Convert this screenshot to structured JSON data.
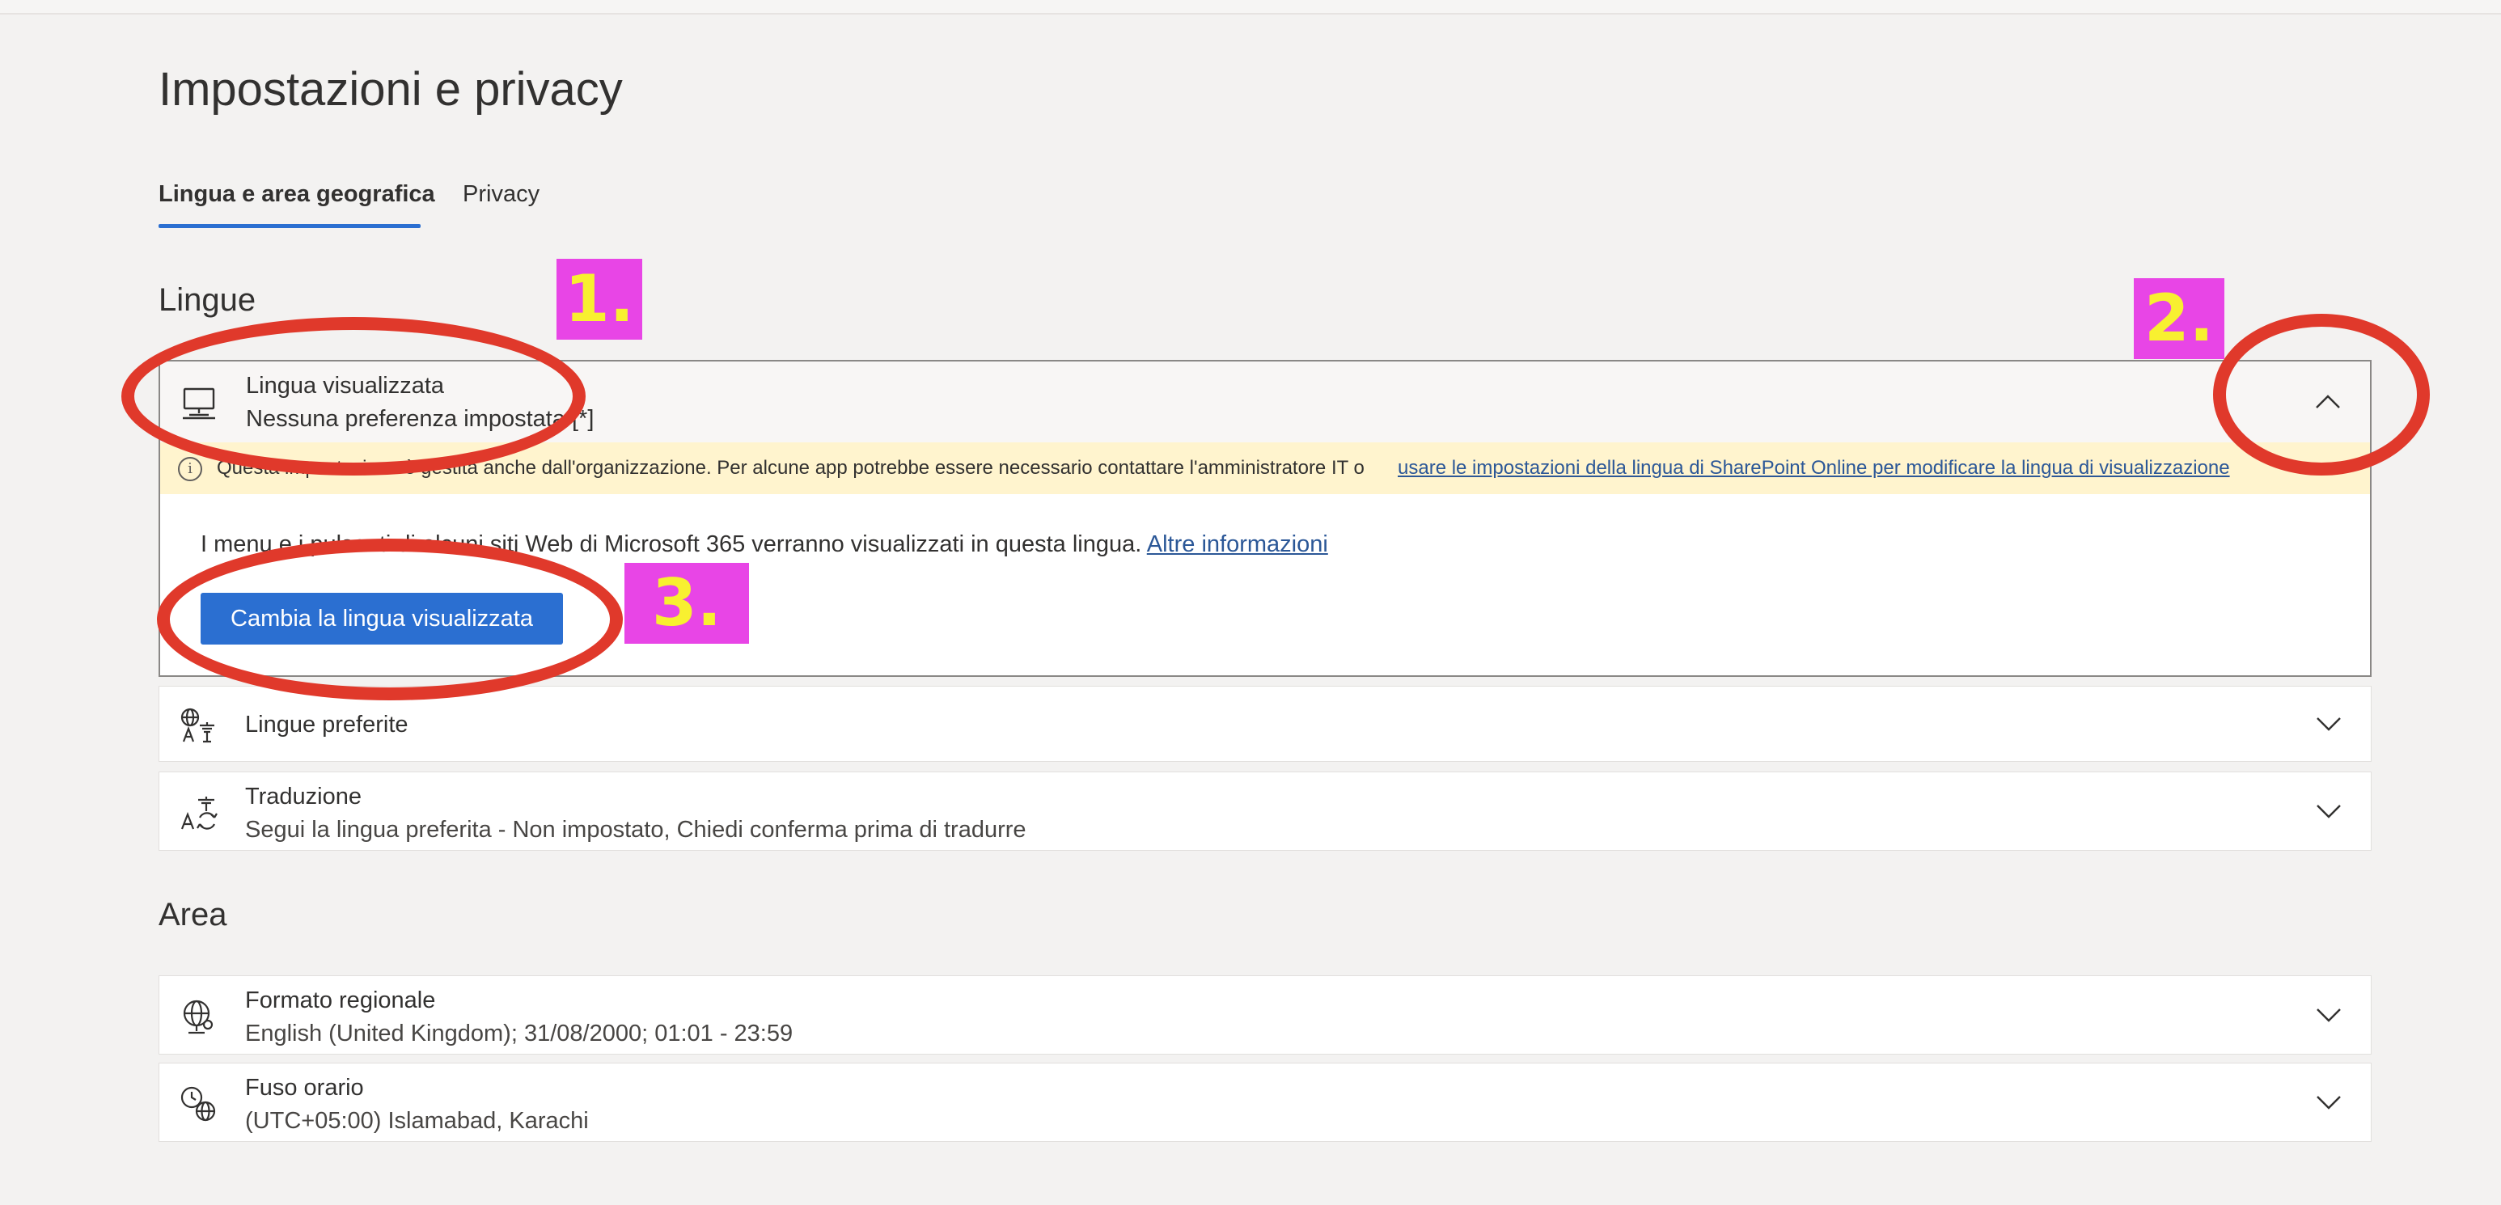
{
  "page": {
    "title": "Impostazioni e privacy"
  },
  "tabs": [
    {
      "label": "Lingua e area geografica",
      "active": true
    },
    {
      "label": "Privacy",
      "active": false
    }
  ],
  "sections": {
    "languages": {
      "title": "Lingue",
      "display_language": {
        "title": "Lingua visualizzata",
        "subtitle": "Nessuna preferenza impostata [*]",
        "icon": "monitor-icon",
        "expanded": true,
        "notice_text": "Questa impostazione è gestita anche dall'organizzazione. Per alcune app potrebbe essere necessario contattare l'amministratore IT o",
        "notice_link": "usare le impostazioni della lingua di SharePoint Online per modificare la lingua di visualizzazione",
        "description": "I menu e i pulsanti di alcuni siti Web di Microsoft 365 verranno visualizzati in questa lingua.",
        "description_link": "Altre informazioni",
        "button_label": "Cambia la lingua visualizzata"
      },
      "preferred": {
        "title": "Lingue preferite",
        "icon": "language-icon"
      },
      "translation": {
        "title": "Traduzione",
        "subtitle": "Segui la lingua preferita - Non impostato, Chiedi conferma prima di tradurre",
        "icon": "translate-icon"
      }
    },
    "area": {
      "title": "Area",
      "regional_format": {
        "title": "Formato regionale",
        "subtitle": "English (United Kingdom); 31/08/2000; 01:01 - 23:59",
        "icon": "globe-settings-icon"
      },
      "time_zone": {
        "title": "Fuso orario",
        "subtitle": "(UTC+05:00) Islamabad, Karachi",
        "icon": "clock-globe-icon"
      }
    }
  },
  "annotations": [
    {
      "label": "1."
    },
    {
      "label": "2."
    },
    {
      "label": "3."
    }
  ],
  "colors": {
    "accent": "#2b6fd1",
    "callout_bg": "#e845e6",
    "callout_text": "#f8f030",
    "ring": "#e0392b",
    "notice_bg": "#fff4ce"
  }
}
